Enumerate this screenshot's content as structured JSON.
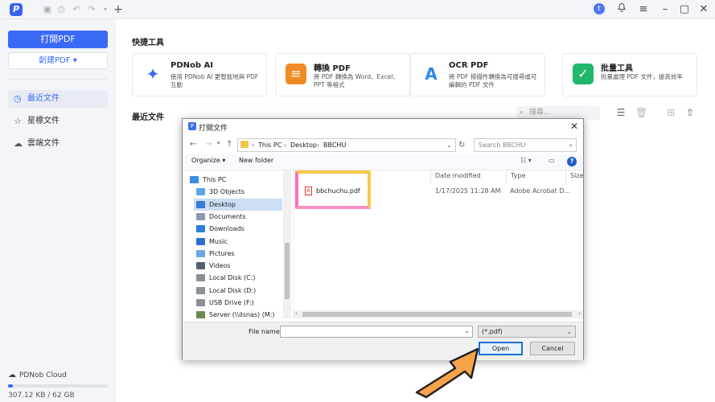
{
  "titlebar": {
    "app_logo": "P",
    "user_initial": "t",
    "icons": [
      "save-icon",
      "print-icon",
      "undo-icon",
      "redo-icon",
      "dropdown-icon",
      "new-tab-icon",
      "bell-icon",
      "menu-icon",
      "minimize-icon",
      "maximize-icon",
      "close-icon"
    ]
  },
  "sidebar": {
    "open_pdf": "打開PDF",
    "create_pdf": "創建PDF ▾",
    "items": [
      {
        "label": "最近文件",
        "icon": "clock-icon",
        "active": true
      },
      {
        "label": "星標文件",
        "icon": "star-icon",
        "active": false
      },
      {
        "label": "雲端文件",
        "icon": "cloud-icon",
        "active": false
      }
    ],
    "cloud_label": "PDNob Cloud",
    "storage_text": "307.12 KB  /  62 GB",
    "storage_fraction": 0.05
  },
  "main": {
    "quick_tools_title": "快捷工具",
    "recent_title": "最近文件",
    "search_placeholder": "搜尋...",
    "tools": [
      {
        "name": "PDNob AI",
        "desc": "使用 PDNob AI 更智能地與 PDF 互動",
        "color": "#ffffff"
      },
      {
        "name": "轉換 PDF",
        "desc": "將 PDF 轉換為 Word、Excel、PPT 等格式",
        "color": "#f08a24"
      },
      {
        "name": "OCR PDF",
        "desc": "將 PDF 掃描件轉換為可搜尋或可編輯的 PDF 文件",
        "color": "#2a8be8"
      },
      {
        "name": "批量工具",
        "desc": "批量處理 PDF 文件，提高效率",
        "color": "#20b86a"
      }
    ]
  },
  "dialog": {
    "title": "打開文件",
    "path": [
      "This PC",
      "Desktop",
      "BBCHU"
    ],
    "search_placeholder": "Search BBCHU",
    "organize": "Organize ▾",
    "new_folder": "New folder",
    "help": "?",
    "nav_items": [
      {
        "label": "This PC",
        "icon_color": "#3b8ee0",
        "selected": false,
        "indent": 0
      },
      {
        "label": "3D Objects",
        "icon_color": "#5aa7e8",
        "selected": false,
        "indent": 1
      },
      {
        "label": "Desktop",
        "icon_color": "#3b7ad6",
        "selected": true,
        "indent": 1
      },
      {
        "label": "Documents",
        "icon_color": "#8b99ad",
        "selected": false,
        "indent": 1
      },
      {
        "label": "Downloads",
        "icon_color": "#2a7fd8",
        "selected": false,
        "indent": 1
      },
      {
        "label": "Music",
        "icon_color": "#2b6fd0",
        "selected": false,
        "indent": 1
      },
      {
        "label": "Pictures",
        "icon_color": "#6aa7e0",
        "selected": false,
        "indent": 1
      },
      {
        "label": "Videos",
        "icon_color": "#555e6b",
        "selected": false,
        "indent": 1
      },
      {
        "label": "Local Disk (C:)",
        "icon_color": "#8a8f98",
        "selected": false,
        "indent": 1
      },
      {
        "label": "Local Disk (D:)",
        "icon_color": "#8a8f98",
        "selected": false,
        "indent": 1
      },
      {
        "label": "USB Drive (F:)",
        "icon_color": "#8a8f98",
        "selected": false,
        "indent": 1
      },
      {
        "label": "Server (\\\\ilsnas) (M:)",
        "icon_color": "#6c8a4f",
        "selected": false,
        "indent": 1
      }
    ],
    "columns": [
      "Date modified",
      "Type",
      "Size"
    ],
    "files": [
      {
        "name": "bbchuchu.pdf",
        "date": "1/17/2025 11:28 AM",
        "type": "Adobe Acrobat D..."
      }
    ],
    "file_name_label": "File name:",
    "file_name_value": "",
    "file_type": "(*.pdf)",
    "open": "Open",
    "cancel": "Cancel"
  }
}
